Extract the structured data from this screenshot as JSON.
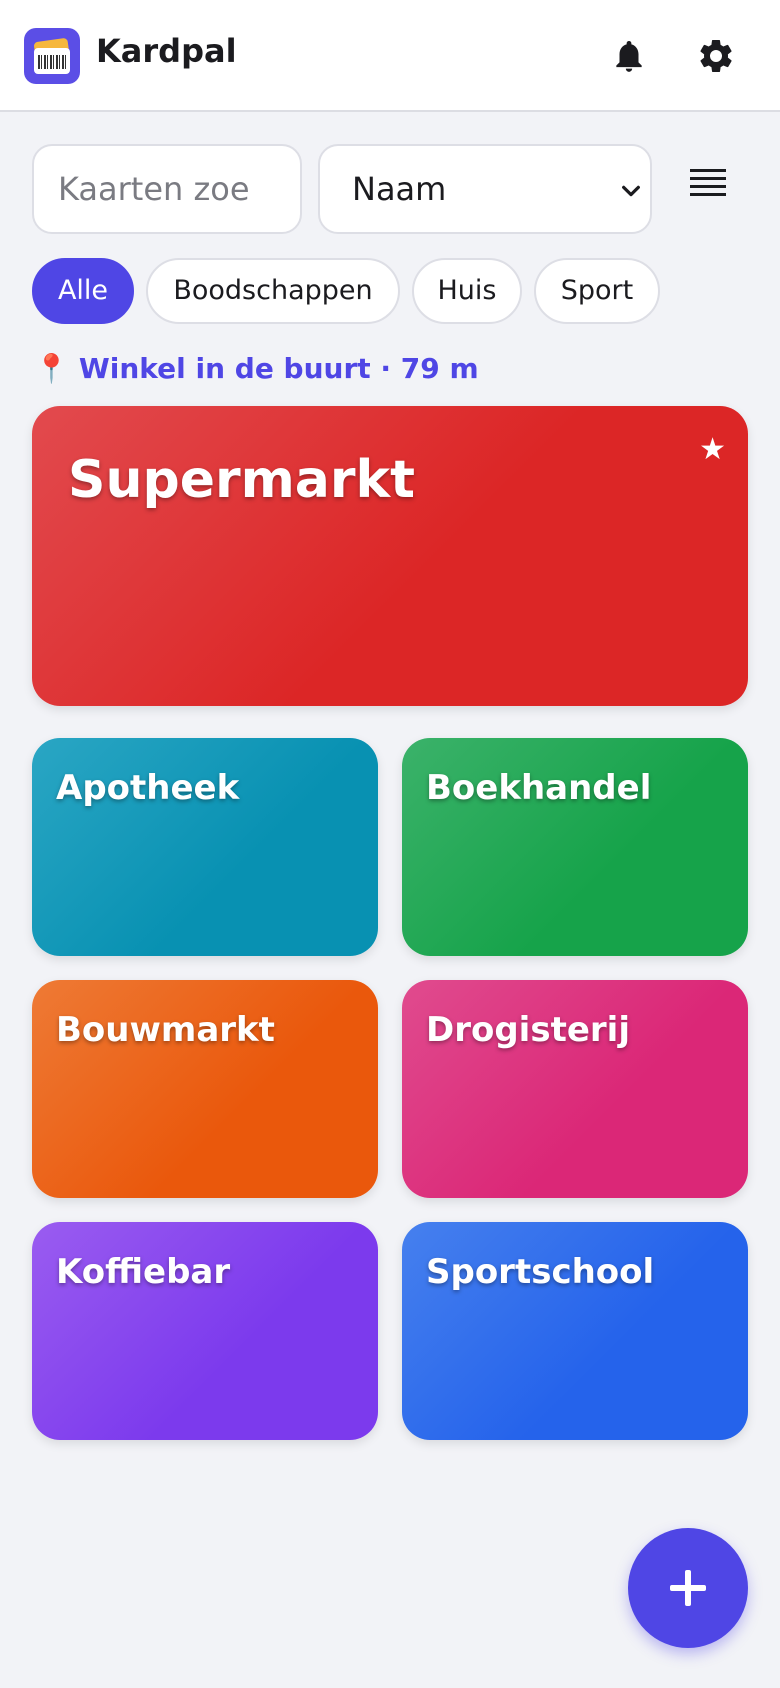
{
  "app": {
    "title": "Kardpal"
  },
  "header": {
    "icons": [
      "bell-icon",
      "gear-icon"
    ]
  },
  "search": {
    "placeholder": "Kaarten zoe"
  },
  "sort": {
    "selected": "Naam"
  },
  "filters": [
    {
      "label": "Alle",
      "active": true
    },
    {
      "label": "Boodschappen",
      "active": false
    },
    {
      "label": "Huis",
      "active": false
    },
    {
      "label": "Sport",
      "active": false
    }
  ],
  "nearby": {
    "icon": "📍",
    "text": "Winkel in de buurt · 79 m"
  },
  "featured_card": {
    "name": "Supermarkt",
    "favorite_icon": "★",
    "color": "#dc2626"
  },
  "cards": [
    {
      "name": "Apotheek",
      "color": "#0891b2"
    },
    {
      "name": "Boekhandel",
      "color": "#16a34a"
    },
    {
      "name": "Bouwmarkt",
      "color": "#ea580c"
    },
    {
      "name": "Drogisterij",
      "color": "#db2777"
    },
    {
      "name": "Koffiebar",
      "color": "#7c3aed"
    },
    {
      "name": "Sportschool",
      "color": "#2563eb"
    }
  ],
  "colors": {
    "accent": "#4f46e5",
    "background": "#f2f3f7"
  }
}
